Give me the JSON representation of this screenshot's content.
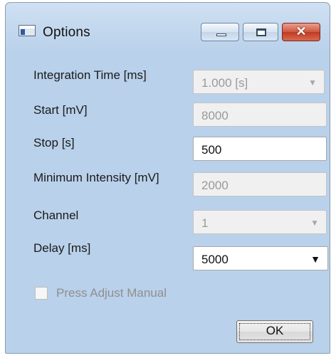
{
  "window": {
    "title": "Options",
    "close_glyph": "✕",
    "icons": {
      "app": "app-window-icon",
      "minimize": "minimize-icon",
      "maximize": "maximize-icon",
      "close": "close-icon"
    }
  },
  "form": {
    "integration_time": {
      "label": "Integration Time [ms]",
      "value": "1.000 [s]"
    },
    "start": {
      "label": "Start [mV]",
      "value": "8000"
    },
    "stop": {
      "label": "Stop [s]",
      "value": "500"
    },
    "min_intensity": {
      "label": "Minimum Intensity [mV]",
      "value": "2000"
    },
    "channel": {
      "label": "Channel",
      "value": "1"
    },
    "delay": {
      "label": "Delay [ms]",
      "value": "5000"
    },
    "press_adjust": {
      "label": "Press Adjust Manual",
      "checked": false
    },
    "ok_label": "OK",
    "dropdown_glyph": "▼"
  }
}
